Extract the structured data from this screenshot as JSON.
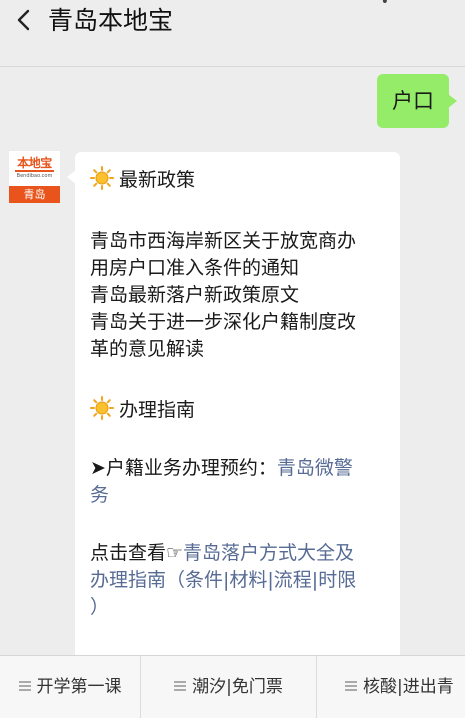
{
  "header": {
    "title": "青岛本地宝"
  },
  "conversation": {
    "user_message": "户口",
    "bot_avatar": {
      "logo_text": "本地宝",
      "logo_url": "Bendibao.com",
      "city": "青岛"
    },
    "bot_message": {
      "section1_title": "最新政策",
      "policy_lines": [
        "青岛市西海岸新区关于放宽商办",
        "用房户口准入条件的通知",
        "青岛最新落户新政策原文",
        "青岛关于进一步深化户籍制度改",
        "革的意见解读"
      ],
      "section2_title": "办理指南",
      "appointment_prefix": "➤户籍业务办理预约：",
      "appointment_link_1": "青岛微警",
      "appointment_link_2": "务",
      "view_prefix": "点击查看☞",
      "view_link_1": "青岛落户方式大全及",
      "view_link_2": "办理指南（条件|材料|流程|时限",
      "view_link_3": "）"
    }
  },
  "bottom_menu": {
    "items": [
      "开学第一课",
      "潮汐|免门票",
      "核酸|进出青"
    ]
  },
  "colors": {
    "user_bubble": "#95ec69",
    "link": "#576b95",
    "brand": "#e8541b"
  },
  "icons": {
    "back": "chevron-left-icon",
    "sun": "sun-icon",
    "menu": "menu-lines-icon"
  }
}
